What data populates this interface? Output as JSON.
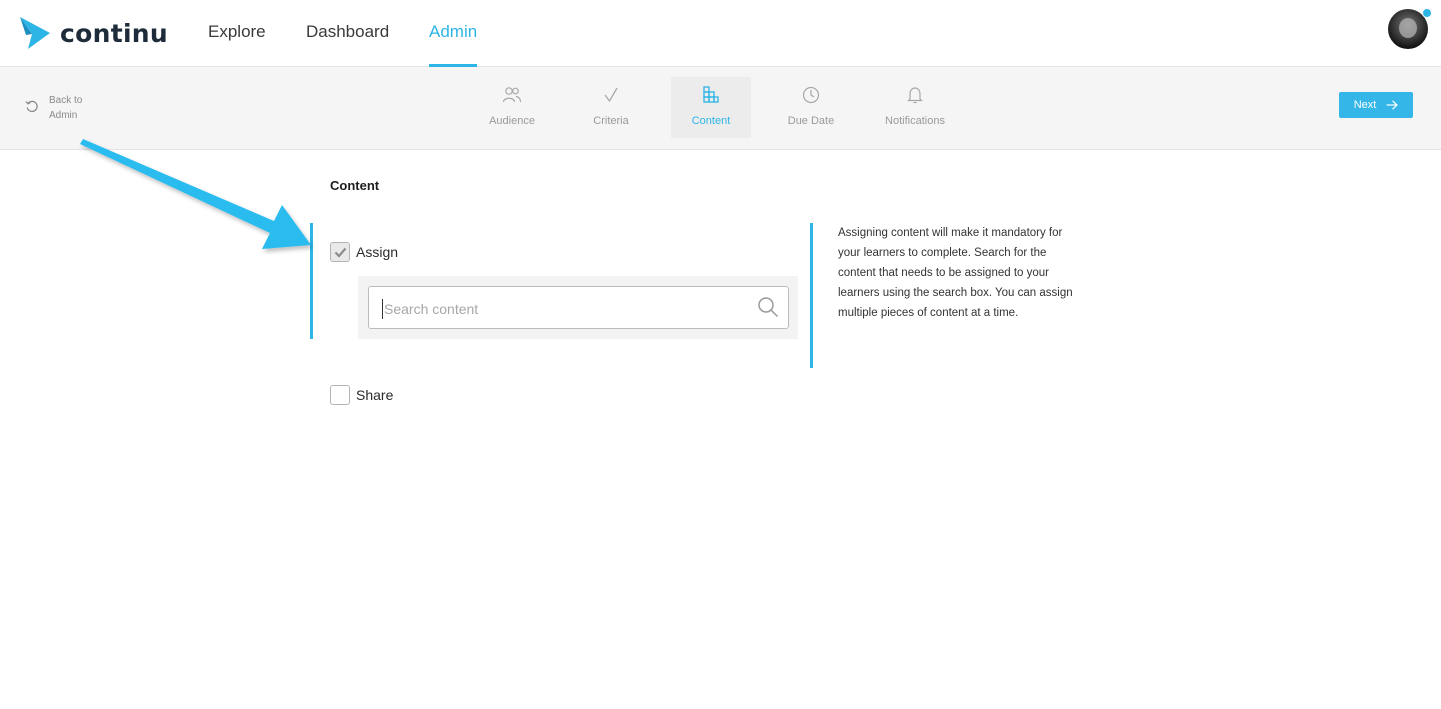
{
  "app": {
    "brand": "continu"
  },
  "topnav": {
    "links": [
      {
        "label": "Explore"
      },
      {
        "label": "Dashboard"
      },
      {
        "label": "Admin",
        "active": true
      }
    ],
    "accent": "#2db5e6"
  },
  "stepbar": {
    "back_label": "Back to Admin",
    "steps": [
      {
        "label": "Audience",
        "icon": "users-icon"
      },
      {
        "label": "Criteria",
        "icon": "checkmark-icon"
      },
      {
        "label": "Content",
        "icon": "content-icon",
        "active": true
      },
      {
        "label": "Due Date",
        "icon": "clock-icon"
      },
      {
        "label": "Notifications",
        "icon": "bell-icon"
      }
    ],
    "next_label": "Next"
  },
  "main": {
    "section_title": "Content",
    "assign": {
      "label": "Assign",
      "checked": true
    },
    "search": {
      "placeholder": "Search content",
      "value": ""
    },
    "share": {
      "label": "Share",
      "checked": false
    },
    "help_text": "Assigning content will make it mandatory for your learners to complete. Search for the content that needs to be assigned to your learners using the search box. You can assign multiple pieces of content at a time."
  }
}
